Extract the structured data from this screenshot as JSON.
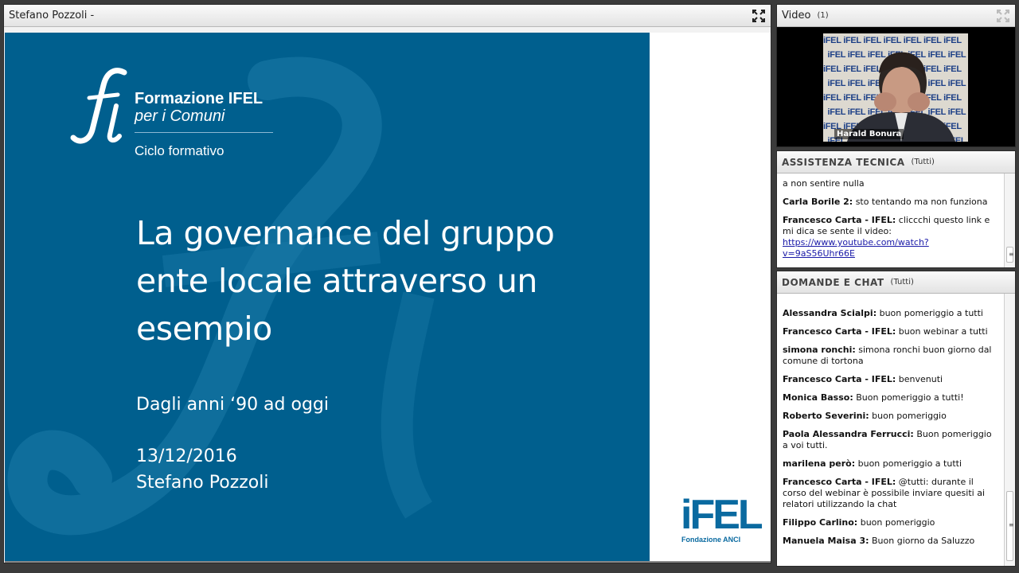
{
  "share": {
    "title": "Stefano Pozzoli -",
    "slide": {
      "brand_line1": "Formazione IFEL",
      "brand_line2": "per i Comuni",
      "brand_line3": "Ciclo formativo",
      "title_lines": [
        "La governance del gruppo",
        "ente locale attraverso un",
        "esempio"
      ],
      "subtitle": "Dagli anni ‘90 ad oggi",
      "date": "13/12/2016",
      "author": "Stefano Pozzoli",
      "ifel_logo": "iFEL",
      "ifel_sub": "Fondazione ANCI"
    }
  },
  "video": {
    "title": "Video",
    "count": "(1)",
    "speaker": "Harald Bonura",
    "backdrop_text": "iFEL"
  },
  "assist": {
    "title": "ASSISTENZA TECNICA",
    "audience": "(Tutti)",
    "messages": [
      {
        "who": "",
        "text": "a non sentire nulla"
      },
      {
        "who": "Carla Borile 2:",
        "text": " sto tentando ma non funziona"
      },
      {
        "who": "Francesco Carta - IFEL:",
        "text": " cliccchi questo link e mi dica se sente il video:",
        "link": " https://www.youtube.com/watch?v=9aS56Uhr66E"
      }
    ]
  },
  "chat": {
    "title": "DOMANDE E CHAT",
    "audience": "(Tutti)",
    "messages": [
      {
        "who": "Alessandra Scialpi:",
        "text": " buon pomeriggio a tutti"
      },
      {
        "who": "Francesco Carta - IFEL:",
        "text": " buon webinar a tutti"
      },
      {
        "who": "simona ronchi:",
        "text": " simona ronchi buon giorno dal comune di tortona"
      },
      {
        "who": "Francesco Carta - IFEL:",
        "text": " benvenuti"
      },
      {
        "who": "Monica Basso:",
        "text": " Buon pomeriggio a tutti!"
      },
      {
        "who": "Roberto Severini:",
        "text": " buon pomeriggio"
      },
      {
        "who": "Paola Alessandra  Ferrucci:",
        "text": " Buon pomeriggio a voi tutti."
      },
      {
        "who": "marilena però:",
        "text": " buon pomeriggio a tutti"
      },
      {
        "who": "Francesco Carta - IFEL:",
        "text": " @tutti: durante il corso del webinar è possibile inviare quesiti ai relatori utilizzando la chat"
      },
      {
        "who": "Filippo Carlino:",
        "text": " buon pomeriggio"
      },
      {
        "who": "Manuela Maisa 3:",
        "text": " Buon giorno da Saluzzo"
      }
    ]
  },
  "colors": {
    "slide_blue": "#005f8e",
    "ifel_blue": "#0a6aa0",
    "link": "#1a1aa8"
  }
}
